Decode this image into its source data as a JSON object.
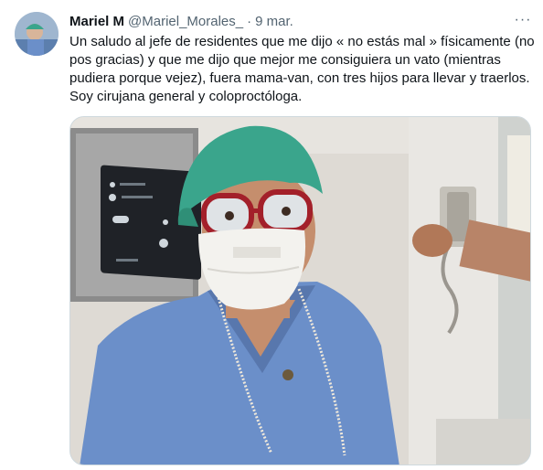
{
  "tweet": {
    "display_name": "Mariel M",
    "handle": "@Mariel_Morales_",
    "separator": "·",
    "time": "9 mar.",
    "more_glyph": "···",
    "text": "Un saludo al jefe de residentes que me dijo « no estás mal » físicamente (no\npos gracias) y que me dijo que mejor me consiguiera un vato (mientras\npudiera porque vejez), fuera mama-van, con tres hijos para llevar y traerlos.\nSoy cirujana general y coloproctóloga."
  },
  "colors": {
    "text_primary": "#0f1419",
    "text_secondary": "#536471",
    "border": "#cfd9de",
    "scrub_blue": "#6b8fc9",
    "cap_green": "#3aa58c",
    "glasses_red": "#a3202a"
  },
  "icons": {
    "more": "more-horizontal-icon"
  }
}
